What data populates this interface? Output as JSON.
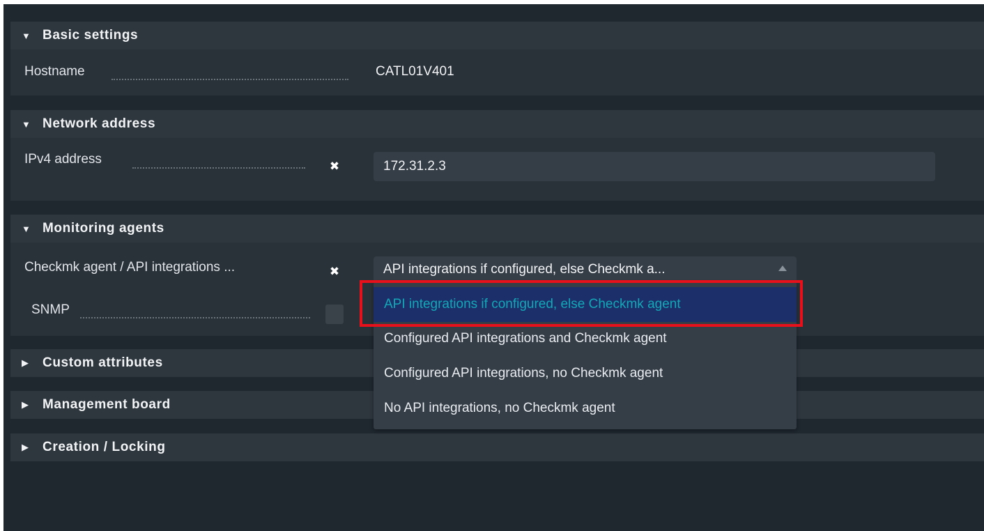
{
  "sections": {
    "basic": {
      "title": "Basic settings",
      "hostname_label": "Hostname",
      "hostname_value": "CATL01V401"
    },
    "network": {
      "title": "Network address",
      "ipv4_label": "IPv4 address",
      "ipv4_checkbox": "✖",
      "ipv4_value": "172.31.2.3"
    },
    "monitoring": {
      "title": "Monitoring agents",
      "agent_label": "Checkmk agent / API integrations ...",
      "agent_checkbox": "✖",
      "agent_selected": "API integrations if configured, else Checkmk a...",
      "snmp_label": "SNMP"
    },
    "custom": {
      "title": "Custom attributes"
    },
    "management": {
      "title": "Management board"
    },
    "creation": {
      "title": "Creation / Locking"
    }
  },
  "dropdown": {
    "options": [
      "API integrations if configured, else Checkmk agent",
      "Configured API integrations and Checkmk agent",
      "Configured API integrations, no Checkmk agent",
      "No API integrations, no Checkmk agent"
    ],
    "selected_index": 0
  },
  "icons": {
    "expanded": "▼",
    "collapsed": "▶"
  },
  "colors": {
    "background": "#1f272f",
    "section_header": "#2e363e",
    "highlight": "#e8101a",
    "selected_option_text": "#13a8b8",
    "selected_option_bg": "#1d2f6b"
  }
}
